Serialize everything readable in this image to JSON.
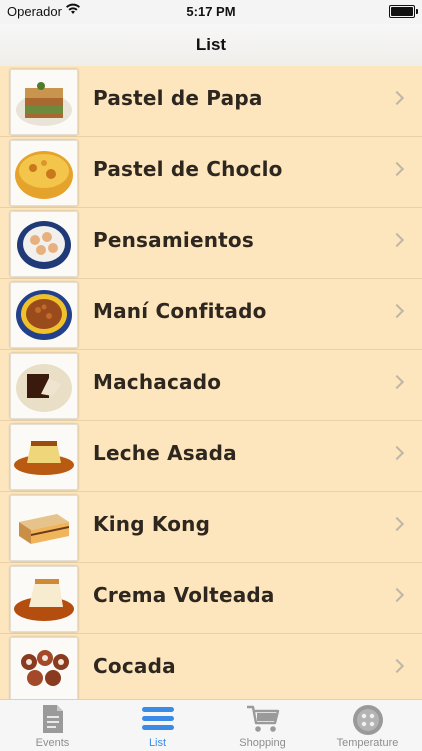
{
  "status_bar": {
    "carrier": "Operador",
    "time": "5:17 PM"
  },
  "nav": {
    "title": "List"
  },
  "items": [
    {
      "label": "Pastel de Papa",
      "image": "pastel-de-papa-photo"
    },
    {
      "label": "Pastel de Choclo",
      "image": "pastel-de-choclo-photo"
    },
    {
      "label": "Pensamientos",
      "image": "pensamientos-photo"
    },
    {
      "label": "Maní Confitado",
      "image": "mani-confitado-photo"
    },
    {
      "label": "Machacado",
      "image": "machacado-photo"
    },
    {
      "label": "Leche Asada",
      "image": "leche-asada-photo"
    },
    {
      "label": "King Kong",
      "image": "king-kong-photo"
    },
    {
      "label": "Crema Volteada",
      "image": "crema-volteada-photo"
    },
    {
      "label": "Cocada",
      "image": "cocada-photo"
    }
  ],
  "tabs": [
    {
      "label": "Events",
      "icon": "document-icon",
      "active": false
    },
    {
      "label": "List",
      "icon": "list-icon",
      "active": true
    },
    {
      "label": "Shopping",
      "icon": "cart-icon",
      "active": false
    },
    {
      "label": "Temperature",
      "icon": "dial-icon",
      "active": false
    }
  ],
  "colors": {
    "row_bg": "#fde6bd",
    "active_tab": "#3a8be6",
    "inactive_tab": "#8e8e8e"
  }
}
